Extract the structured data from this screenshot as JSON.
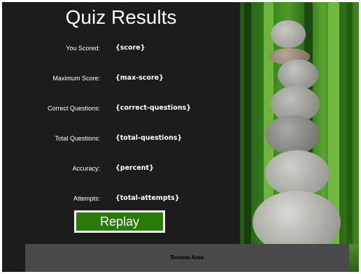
{
  "title": "Quiz Results",
  "results": [
    {
      "label": "You Scored:",
      "value": "{score}"
    },
    {
      "label": "Maximum Score:",
      "value": "{max-score}"
    },
    {
      "label": "Correct Questions:",
      "value": "{correct-questions}"
    },
    {
      "label": "Total Questions:",
      "value": "{total-questions}"
    },
    {
      "label": "Accuracy:",
      "value": "{percent}"
    },
    {
      "label": "Attempts:",
      "value": "{total-attempts}"
    }
  ],
  "replay_label": "Replay",
  "review_label": "Review Area",
  "colors": {
    "background": "#1c1c1c",
    "replay_button": "#2a7a0a",
    "text": "#ffffff"
  }
}
